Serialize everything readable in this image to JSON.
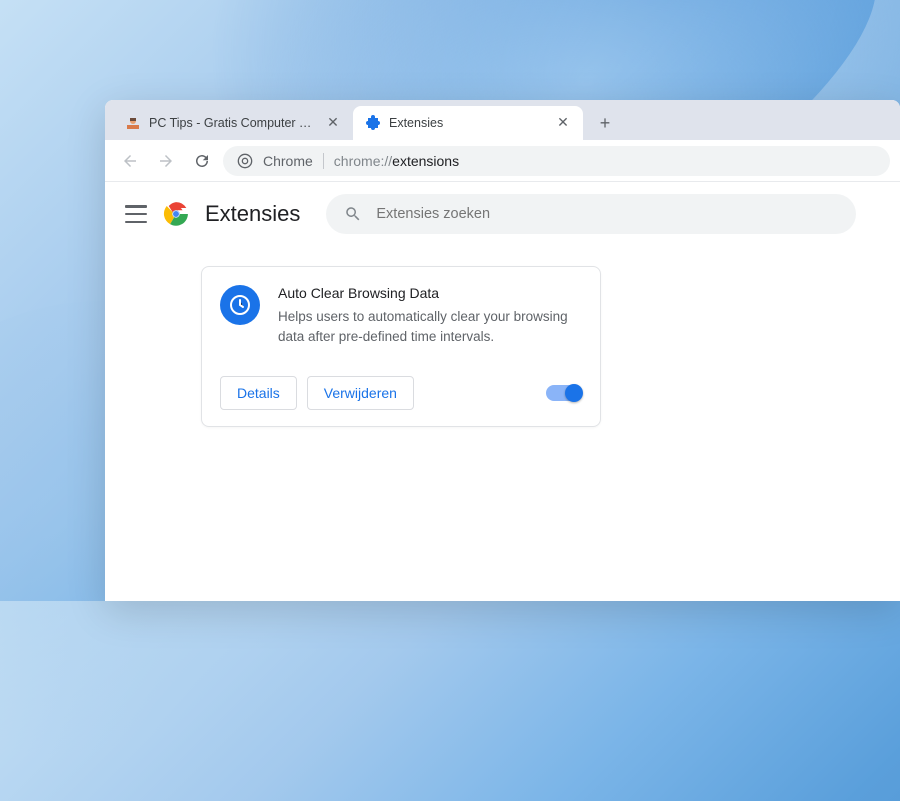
{
  "tabs": [
    {
      "title": "PC Tips - Gratis Computer Tips, i…",
      "active": false
    },
    {
      "title": "Extensies",
      "active": true
    }
  ],
  "omnibox": {
    "prefix": "Chrome",
    "url_gray": "chrome://",
    "url_bold": "extensions"
  },
  "header": {
    "title": "Extensies",
    "search_placeholder": "Extensies zoeken"
  },
  "extension": {
    "name": "Auto Clear Browsing Data",
    "description": "Helps users to automatically clear your browsing data after pre-defined time intervals.",
    "details_label": "Details",
    "remove_label": "Verwijderen",
    "enabled": true
  }
}
